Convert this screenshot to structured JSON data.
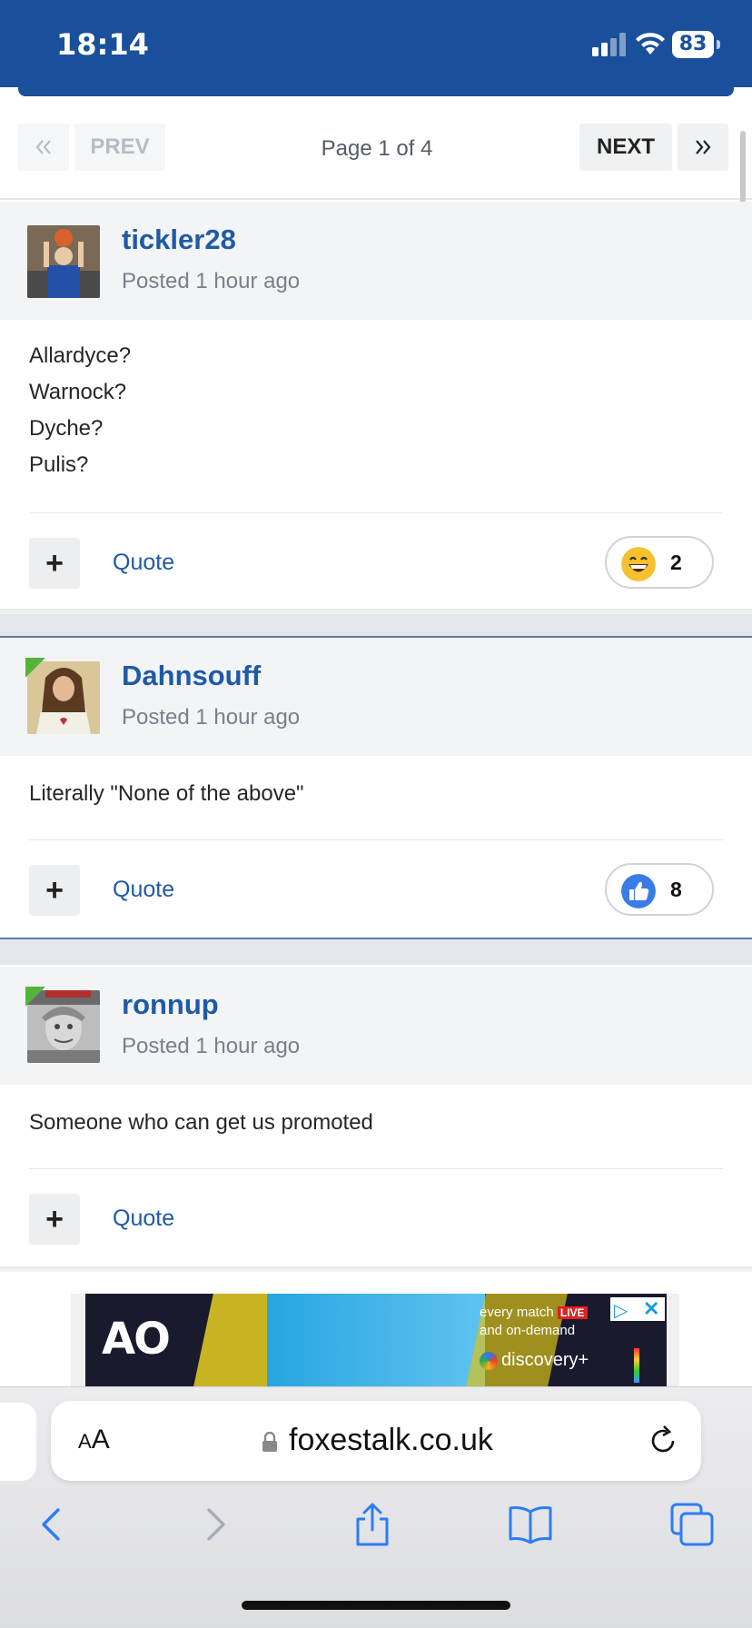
{
  "status_bar": {
    "time": "18:14",
    "battery": "83"
  },
  "pagination": {
    "first_icon": "double-chevron-left-icon",
    "prev_label": "PREV",
    "page_info": "Page 1 of 4",
    "next_label": "NEXT",
    "last_icon": "double-chevron-right-icon"
  },
  "posts": [
    {
      "author": "tickler28",
      "posted": "Posted 1 hour ago",
      "content": [
        "Allardyce?",
        "Warnock?",
        "Dyche?",
        "Pulis?"
      ],
      "quote_label": "Quote",
      "reaction": {
        "icon": "grin-emoji-icon",
        "count": "2"
      },
      "online": false
    },
    {
      "author": "Dahnsouff",
      "posted": "Posted 1 hour ago",
      "content": [
        "Literally \"None of the above\""
      ],
      "quote_label": "Quote",
      "reaction": {
        "icon": "thumbs-up-icon",
        "count": "8"
      },
      "online": true
    },
    {
      "author": "ronnup",
      "posted": "Posted 1 hour ago",
      "content": [
        "Someone who can get us promoted"
      ],
      "quote_label": "Quote",
      "online": true
    }
  ],
  "ad": {
    "brand": "AO",
    "line1": "every match",
    "live": "LIVE",
    "line2": "and on-demand",
    "network": "discovery+"
  },
  "browser": {
    "text_size_label": "AA",
    "url": "foxestalk.co.uk"
  }
}
